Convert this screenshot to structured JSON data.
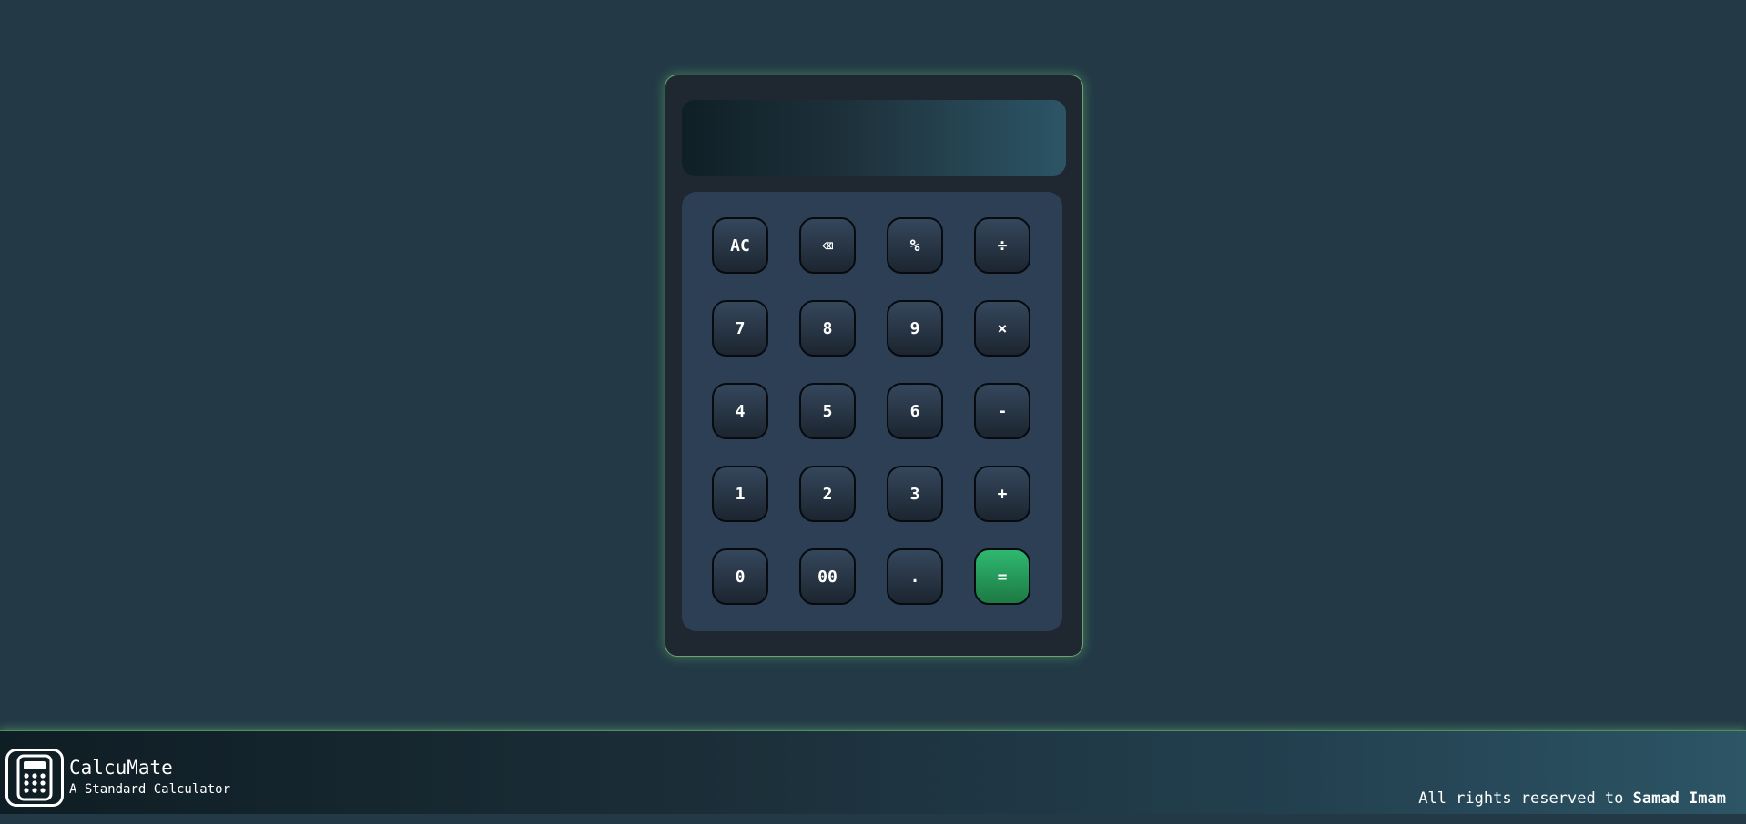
{
  "calculator": {
    "display": {
      "value": ""
    },
    "keys": {
      "all_clear": "AC",
      "backspace": "⌫",
      "percent": "%",
      "divide": "÷",
      "seven": "7",
      "eight": "8",
      "nine": "9",
      "multiply": "×",
      "four": "4",
      "five": "5",
      "six": "6",
      "subtract": "-",
      "one": "1",
      "two": "2",
      "three": "3",
      "add": "+",
      "zero": "0",
      "double_zero": "00",
      "decimal": ".",
      "equals": "="
    }
  },
  "footer": {
    "logo_icon": "calculator-icon",
    "brand_name": "CalcuMate",
    "tagline": "A Standard Calculator",
    "copyright_prefix": "All rights reserved to",
    "author": "Samad Imam"
  },
  "colors": {
    "background": "#233a46",
    "calculator_body": "#1f2730",
    "keypad": "#2d3f55",
    "equals_key": "#2fb870",
    "glow": "#6aa36f"
  }
}
